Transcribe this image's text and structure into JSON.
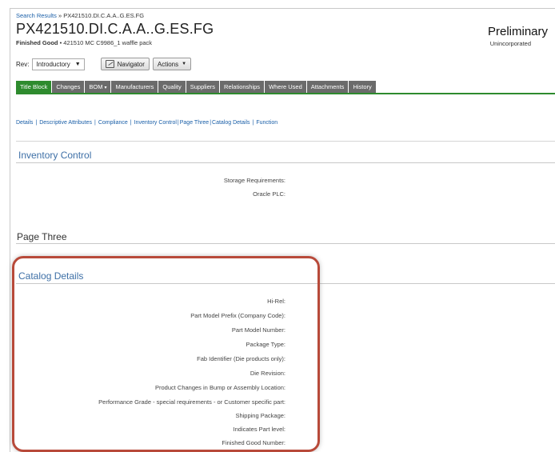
{
  "breadcrumb": {
    "link": "Search Results",
    "separator": " » ",
    "current": "PX421510.DI.C.A.A..G.ES.FG"
  },
  "header": {
    "title": "PX421510.DI.C.A.A..G.ES.FG",
    "subtitle_bold": "Finished Good",
    "subtitle_rest": " • 421510 MC C9986_1 waffle pack",
    "status": "Preliminary",
    "status_sub": "Unincorporated"
  },
  "toolbar": {
    "rev_label": "Rev:",
    "rev_value": "Introductory",
    "navigator_label": "Navigator",
    "actions_label": "Actions"
  },
  "tabs": [
    {
      "label": "Title Block",
      "active": true
    },
    {
      "label": "Changes"
    },
    {
      "label": "BOM"
    },
    {
      "label": "Manufacturers"
    },
    {
      "label": "Quality"
    },
    {
      "label": "Suppliers"
    },
    {
      "label": "Relationships"
    },
    {
      "label": "Where Used"
    },
    {
      "label": "Attachments"
    },
    {
      "label": "History"
    }
  ],
  "subnav": [
    "Details",
    "Descriptive Attributes",
    "Compliance",
    "Inventory Control",
    "Page Three",
    "Catalog Details",
    "Function"
  ],
  "sections": {
    "inventory_control": {
      "title": "Inventory Control",
      "fields": [
        "Storage Requirements:",
        "Oracle PLC:"
      ]
    },
    "page_three": {
      "title": "Page Three"
    },
    "catalog_details": {
      "title": "Catalog Details",
      "fields": [
        "Hi-Rel:",
        "Part Model Prefix (Company Code):",
        "Part Model Number:",
        "Package Type:",
        "Fab Identifier (Die products only):",
        "Die Revision:",
        "Product Changes in Bump or Assembly Location:",
        "Performance Grade - special requirements - or Customer specific part:",
        "Shipping Package:",
        "Indicates Part level:",
        "Finished Good Number:"
      ]
    }
  },
  "colors": {
    "accent_green": "#2e8b2e",
    "link_blue": "#1a5fa8",
    "section_blue": "#3d6fa6",
    "highlight_red": "#b84a3a"
  }
}
